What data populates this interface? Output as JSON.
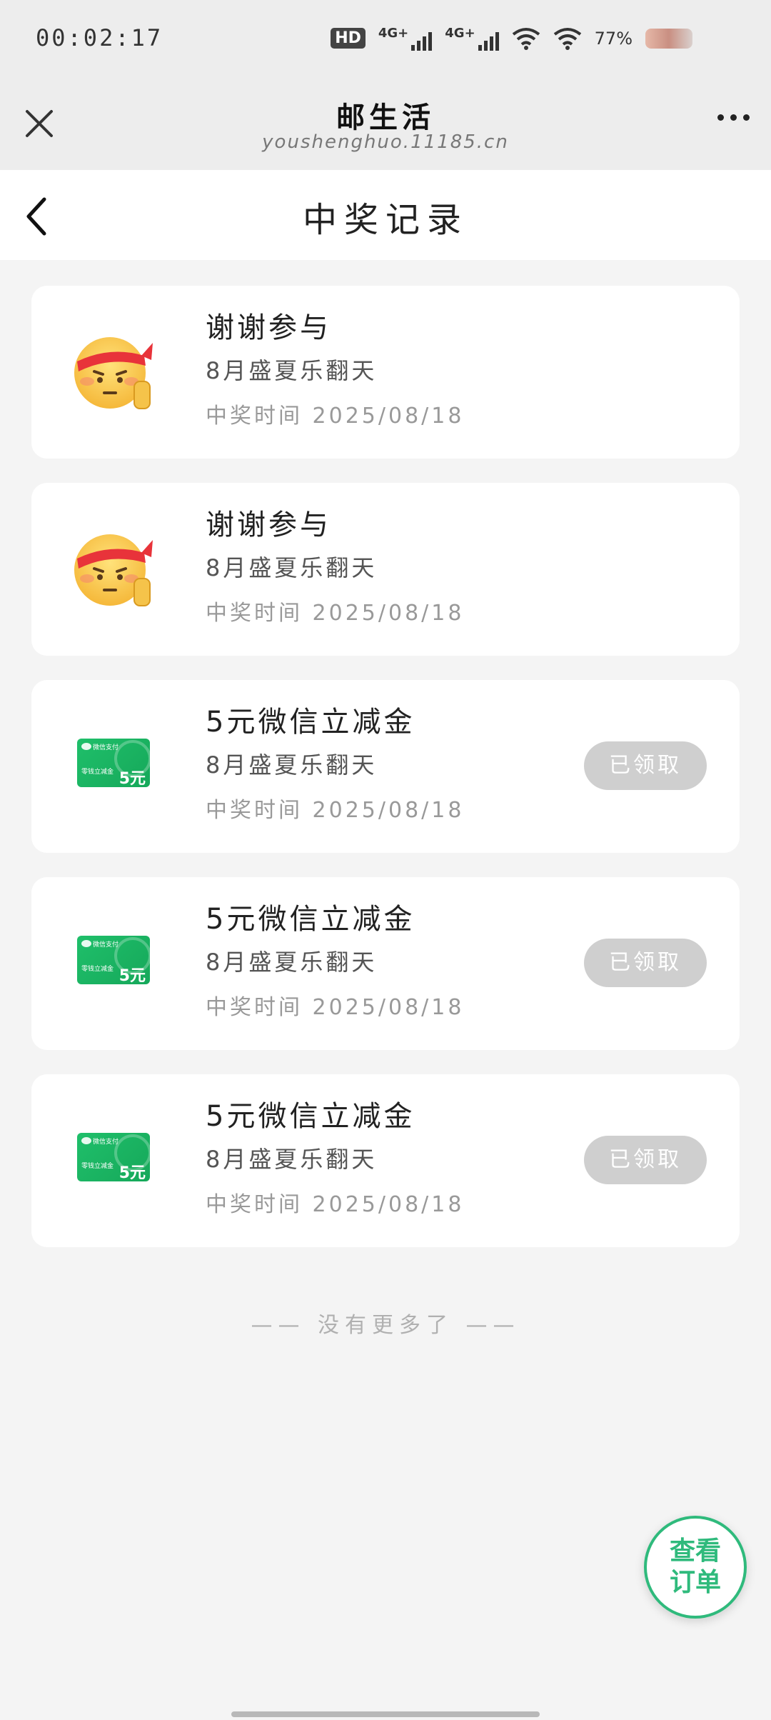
{
  "status_bar": {
    "time": "00:02:17",
    "hd_label": "HD",
    "network_1": "4G+",
    "network_2": "4G+",
    "battery": "77%"
  },
  "titlebar": {
    "title": "邮生活",
    "subtitle": "youshenghuo.11185.cn"
  },
  "page": {
    "title": "中奖记录"
  },
  "records": [
    {
      "icon": "emoji-face-icon",
      "title": "谢谢参与",
      "campaign": "8月盛夏乐翻天",
      "time": "中奖时间 2025/08/18",
      "status": ""
    },
    {
      "icon": "emoji-face-icon",
      "title": "谢谢参与",
      "campaign": "8月盛夏乐翻天",
      "time": "中奖时间 2025/08/18",
      "status": ""
    },
    {
      "icon": "wechat-voucher-icon",
      "title": "5元微信立减金",
      "campaign": "8月盛夏乐翻天",
      "time": "中奖时间 2025/08/18",
      "status": "已领取"
    },
    {
      "icon": "wechat-voucher-icon",
      "title": "5元微信立减金",
      "campaign": "8月盛夏乐翻天",
      "time": "中奖时间 2025/08/18",
      "status": "已领取"
    },
    {
      "icon": "wechat-voucher-icon",
      "title": "5元微信立减金",
      "campaign": "8月盛夏乐翻天",
      "time": "中奖时间 2025/08/18",
      "status": "已领取"
    }
  ],
  "voucher_art": {
    "brand": "微信支付",
    "label": "零钱立减金",
    "amount": "5元"
  },
  "footer": {
    "no_more": "—— 没有更多了 ——",
    "fab_line1": "查看",
    "fab_line2": "订单"
  },
  "colors": {
    "accent": "#2fba7c",
    "claimed_bg": "#cfcfcf",
    "voucher_green": "#1fbf6a"
  }
}
